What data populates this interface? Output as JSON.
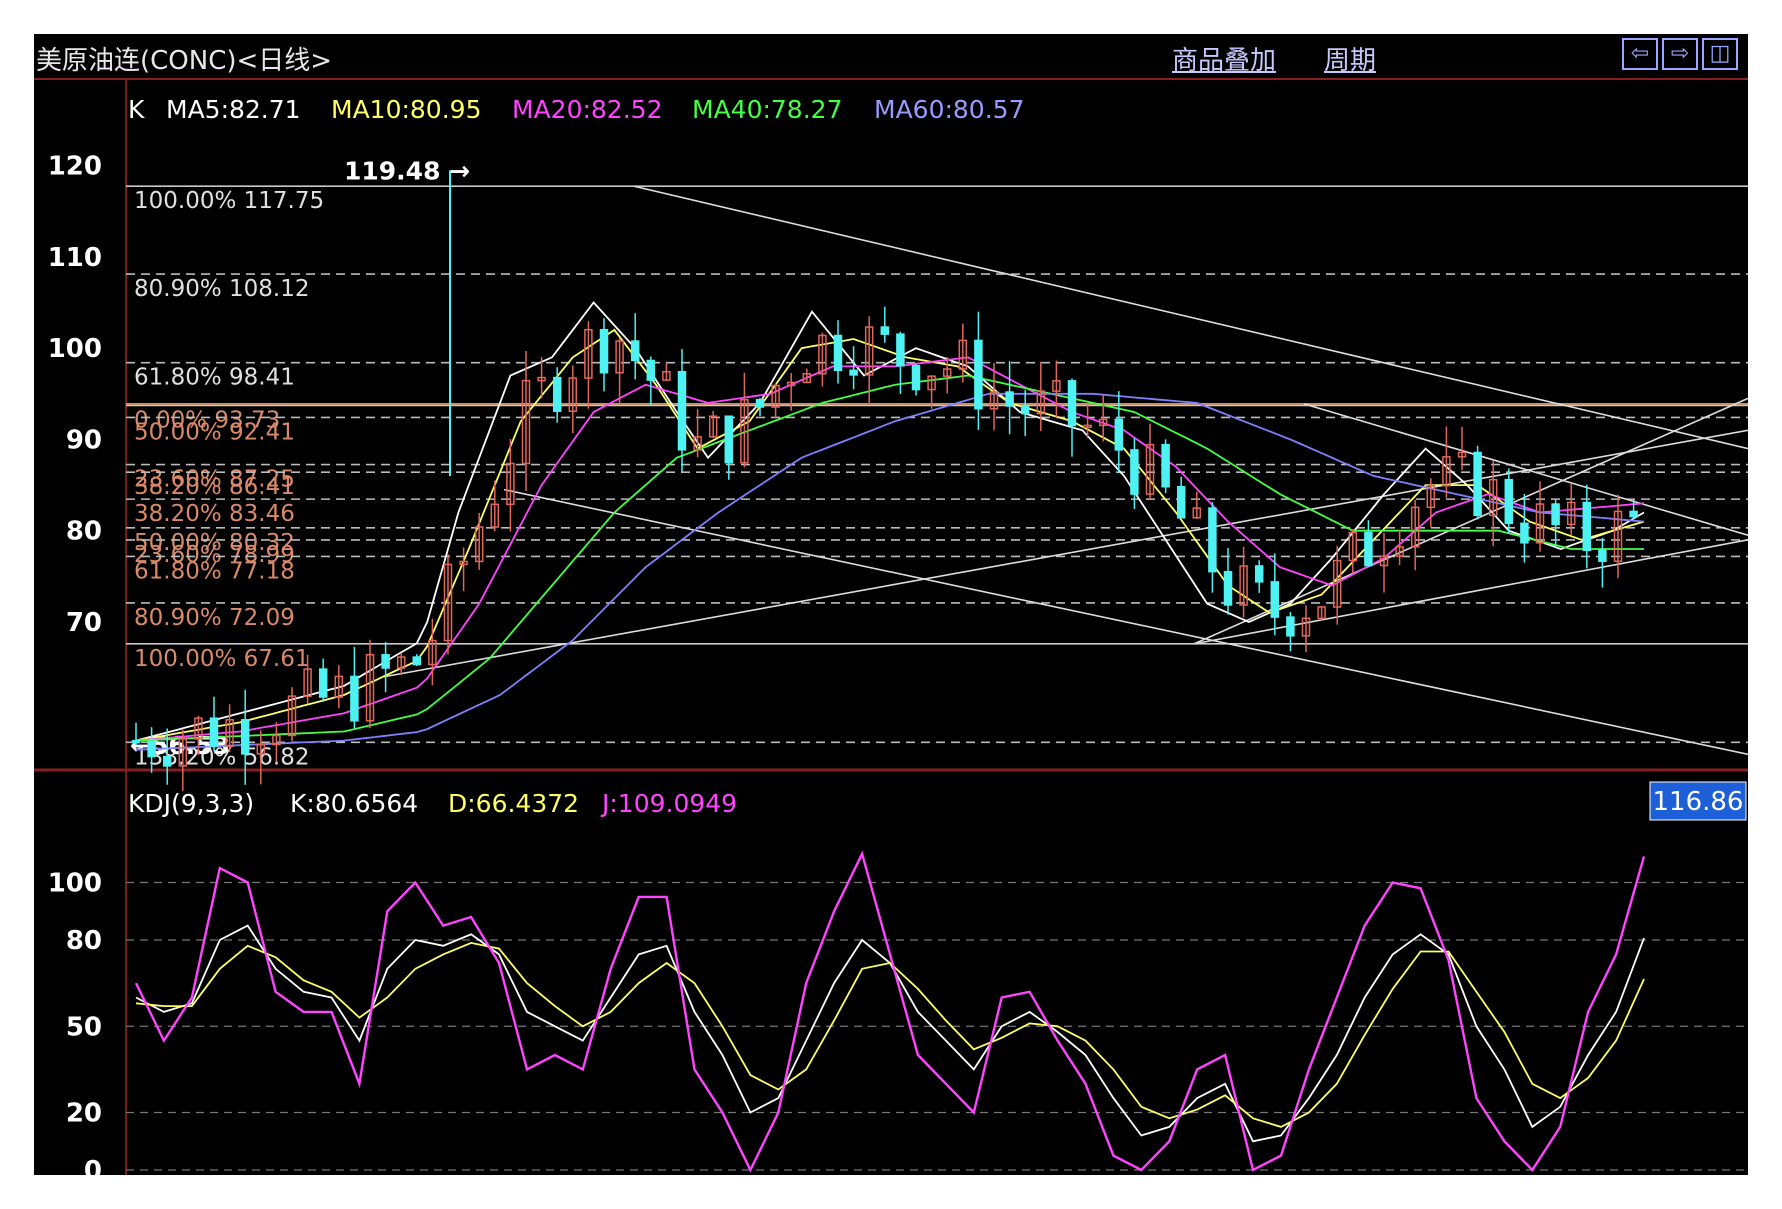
{
  "window": {
    "title": "美原油连(CONC)<日线>",
    "menu_overlay": "商品叠加",
    "menu_period": "周期",
    "nav_icons": [
      "arrow-left-icon",
      "arrow-right-icon",
      "split-window-icon"
    ]
  },
  "colors": {
    "background": "#000000",
    "grid": "#7a1a1a",
    "up_candle": "#e0665a",
    "down_candle": "#4ff2f2",
    "ma5": "#ffffff",
    "ma10": "#ffff66",
    "ma20": "#ff44ff",
    "ma40": "#44ff44",
    "ma60": "#8080ff",
    "kdj_k": "#ffffff",
    "kdj_d": "#ffff66",
    "kdj_j": "#ff44ff"
  },
  "legend_main": {
    "k": "K",
    "ma5": "MA5:82.71",
    "ma10": "MA10:80.95",
    "ma20": "MA20:82.52",
    "ma40": "MA40:78.27",
    "ma60": "MA60:80.57"
  },
  "legend_kdj": {
    "name": "KDJ(9,3,3)",
    "k": "K:80.6564",
    "d": "D:66.4372",
    "j": "J:109.0949"
  },
  "price_tag": "116.86",
  "chart_data": [
    {
      "type": "candlestick",
      "title": "美原油连(CONC)<日线>",
      "ylim": [
        54,
        125
      ],
      "yticks": [
        120,
        110,
        100,
        90,
        80,
        70
      ],
      "high_label": "119.48",
      "low_label": "56.53",
      "fibonacci_levels": [
        {
          "label": "100.00% 117.75",
          "value": 117.75
        },
        {
          "label": "80.90% 108.12",
          "value": 108.12
        },
        {
          "label": "61.80% 98.41",
          "value": 98.41
        },
        {
          "label": "0.00% 93.73",
          "value": 93.73
        },
        {
          "label": "50.00% 92.41",
          "value": 92.41
        },
        {
          "label": "23.60% 87.25",
          "value": 87.25
        },
        {
          "label": "38.20% 86.41",
          "value": 86.41
        },
        {
          "label": "38.20% 83.46",
          "value": 83.46
        },
        {
          "label": "50.00% 80.32",
          "value": 80.32
        },
        {
          "label": "23.60% 78.99",
          "value": 78.99
        },
        {
          "label": "61.80% 77.18",
          "value": 77.18
        },
        {
          "label": "80.90% 72.09",
          "value": 72.09
        },
        {
          "label": "100.00% 67.61",
          "value": 67.61
        },
        {
          "label": "138.20% 56.82",
          "value": 56.82
        }
      ],
      "ma_key_points": {
        "ma5": [
          [
            0,
            57
          ],
          [
            20,
            60
          ],
          [
            40,
            63
          ],
          [
            55,
            68
          ],
          [
            62,
            82
          ],
          [
            72,
            97
          ],
          [
            80,
            99
          ],
          [
            88,
            105
          ],
          [
            96,
            100
          ],
          [
            104,
            93
          ],
          [
            110,
            88
          ],
          [
            120,
            94
          ],
          [
            130,
            104
          ],
          [
            140,
            97
          ],
          [
            150,
            100
          ],
          [
            160,
            98
          ],
          [
            170,
            93
          ],
          [
            182,
            91
          ],
          [
            190,
            86
          ],
          [
            198,
            79
          ],
          [
            206,
            72
          ],
          [
            214,
            70
          ],
          [
            222,
            72
          ],
          [
            230,
            77
          ],
          [
            240,
            84
          ],
          [
            248,
            89
          ],
          [
            256,
            85
          ],
          [
            264,
            80
          ],
          [
            274,
            78
          ],
          [
            284,
            80
          ],
          [
            290,
            82
          ]
        ],
        "ma10": [
          [
            0,
            57
          ],
          [
            20,
            59
          ],
          [
            40,
            62
          ],
          [
            55,
            66
          ],
          [
            64,
            78
          ],
          [
            74,
            92
          ],
          [
            84,
            99
          ],
          [
            92,
            102
          ],
          [
            100,
            96
          ],
          [
            108,
            89
          ],
          [
            118,
            92
          ],
          [
            128,
            100
          ],
          [
            138,
            101
          ],
          [
            148,
            99
          ],
          [
            158,
            98
          ],
          [
            168,
            94
          ],
          [
            180,
            92
          ],
          [
            190,
            89
          ],
          [
            200,
            82
          ],
          [
            210,
            74
          ],
          [
            218,
            71
          ],
          [
            228,
            73
          ],
          [
            238,
            79
          ],
          [
            248,
            85
          ],
          [
            258,
            85
          ],
          [
            268,
            81
          ],
          [
            278,
            79
          ],
          [
            290,
            81
          ]
        ],
        "ma20": [
          [
            0,
            57
          ],
          [
            20,
            58
          ],
          [
            40,
            60
          ],
          [
            55,
            63
          ],
          [
            66,
            72
          ],
          [
            78,
            85
          ],
          [
            88,
            93
          ],
          [
            98,
            96
          ],
          [
            110,
            94
          ],
          [
            122,
            95
          ],
          [
            134,
            98
          ],
          [
            146,
            98
          ],
          [
            160,
            99
          ],
          [
            170,
            96
          ],
          [
            180,
            93
          ],
          [
            190,
            91
          ],
          [
            200,
            87
          ],
          [
            210,
            81
          ],
          [
            220,
            76
          ],
          [
            230,
            74
          ],
          [
            240,
            77
          ],
          [
            250,
            82
          ],
          [
            260,
            84
          ],
          [
            270,
            82
          ],
          [
            290,
            83
          ]
        ],
        "ma40": [
          [
            0,
            57
          ],
          [
            20,
            57.5
          ],
          [
            40,
            58
          ],
          [
            55,
            60
          ],
          [
            68,
            66
          ],
          [
            80,
            74
          ],
          [
            92,
            82
          ],
          [
            104,
            88
          ],
          [
            118,
            91
          ],
          [
            132,
            94
          ],
          [
            146,
            96
          ],
          [
            160,
            97
          ],
          [
            176,
            95
          ],
          [
            192,
            93
          ],
          [
            206,
            89
          ],
          [
            220,
            84
          ],
          [
            234,
            80
          ],
          [
            248,
            80
          ],
          [
            262,
            80
          ],
          [
            276,
            78
          ],
          [
            290,
            78
          ]
        ],
        "ma60": [
          [
            0,
            56
          ],
          [
            20,
            56.5
          ],
          [
            40,
            57
          ],
          [
            55,
            58
          ],
          [
            70,
            62
          ],
          [
            84,
            68
          ],
          [
            98,
            76
          ],
          [
            112,
            82
          ],
          [
            128,
            88
          ],
          [
            146,
            92
          ],
          [
            164,
            95
          ],
          [
            184,
            95
          ],
          [
            204,
            94
          ],
          [
            222,
            90
          ],
          [
            238,
            86
          ],
          [
            254,
            84
          ],
          [
            270,
            82
          ],
          [
            290,
            81
          ]
        ]
      },
      "last_candle": {
        "value": 82.71
      }
    },
    {
      "type": "line",
      "title": "KDJ(9,3,3)",
      "ylim": [
        0,
        120
      ],
      "yticks": [
        100,
        80,
        50,
        20,
        0
      ],
      "series": [
        {
          "name": "K",
          "values": [
            60,
            55,
            58,
            80,
            85,
            70,
            62,
            60,
            45,
            70,
            80,
            78,
            82,
            75,
            55,
            50,
            45,
            60,
            75,
            78,
            55,
            40,
            20,
            25,
            45,
            65,
            80,
            72,
            55,
            45,
            35,
            50,
            55,
            48,
            40,
            25,
            12,
            15,
            25,
            30,
            10,
            12,
            25,
            40,
            60,
            75,
            82,
            75,
            50,
            35,
            15,
            22,
            40,
            55,
            80.6564
          ]
        },
        {
          "name": "D",
          "values": [
            58,
            57,
            57,
            70,
            78,
            74,
            66,
            62,
            53,
            60,
            70,
            75,
            79,
            77,
            65,
            57,
            50,
            55,
            65,
            72,
            65,
            50,
            33,
            28,
            35,
            52,
            70,
            72,
            63,
            52,
            42,
            46,
            51,
            50,
            45,
            35,
            22,
            18,
            21,
            26,
            18,
            15,
            20,
            30,
            47,
            63,
            76,
            76,
            62,
            48,
            30,
            25,
            32,
            45,
            66.4372
          ]
        },
        {
          "name": "J",
          "values": [
            65,
            45,
            60,
            105,
            100,
            62,
            55,
            55,
            30,
            90,
            100,
            85,
            88,
            72,
            35,
            40,
            35,
            70,
            95,
            95,
            35,
            20,
            0,
            20,
            65,
            90,
            110,
            75,
            40,
            30,
            20,
            60,
            62,
            45,
            30,
            5,
            0,
            10,
            35,
            40,
            0,
            5,
            35,
            60,
            85,
            100,
            98,
            73,
            25,
            10,
            0,
            15,
            55,
            75,
            109.0949
          ]
        }
      ]
    }
  ]
}
